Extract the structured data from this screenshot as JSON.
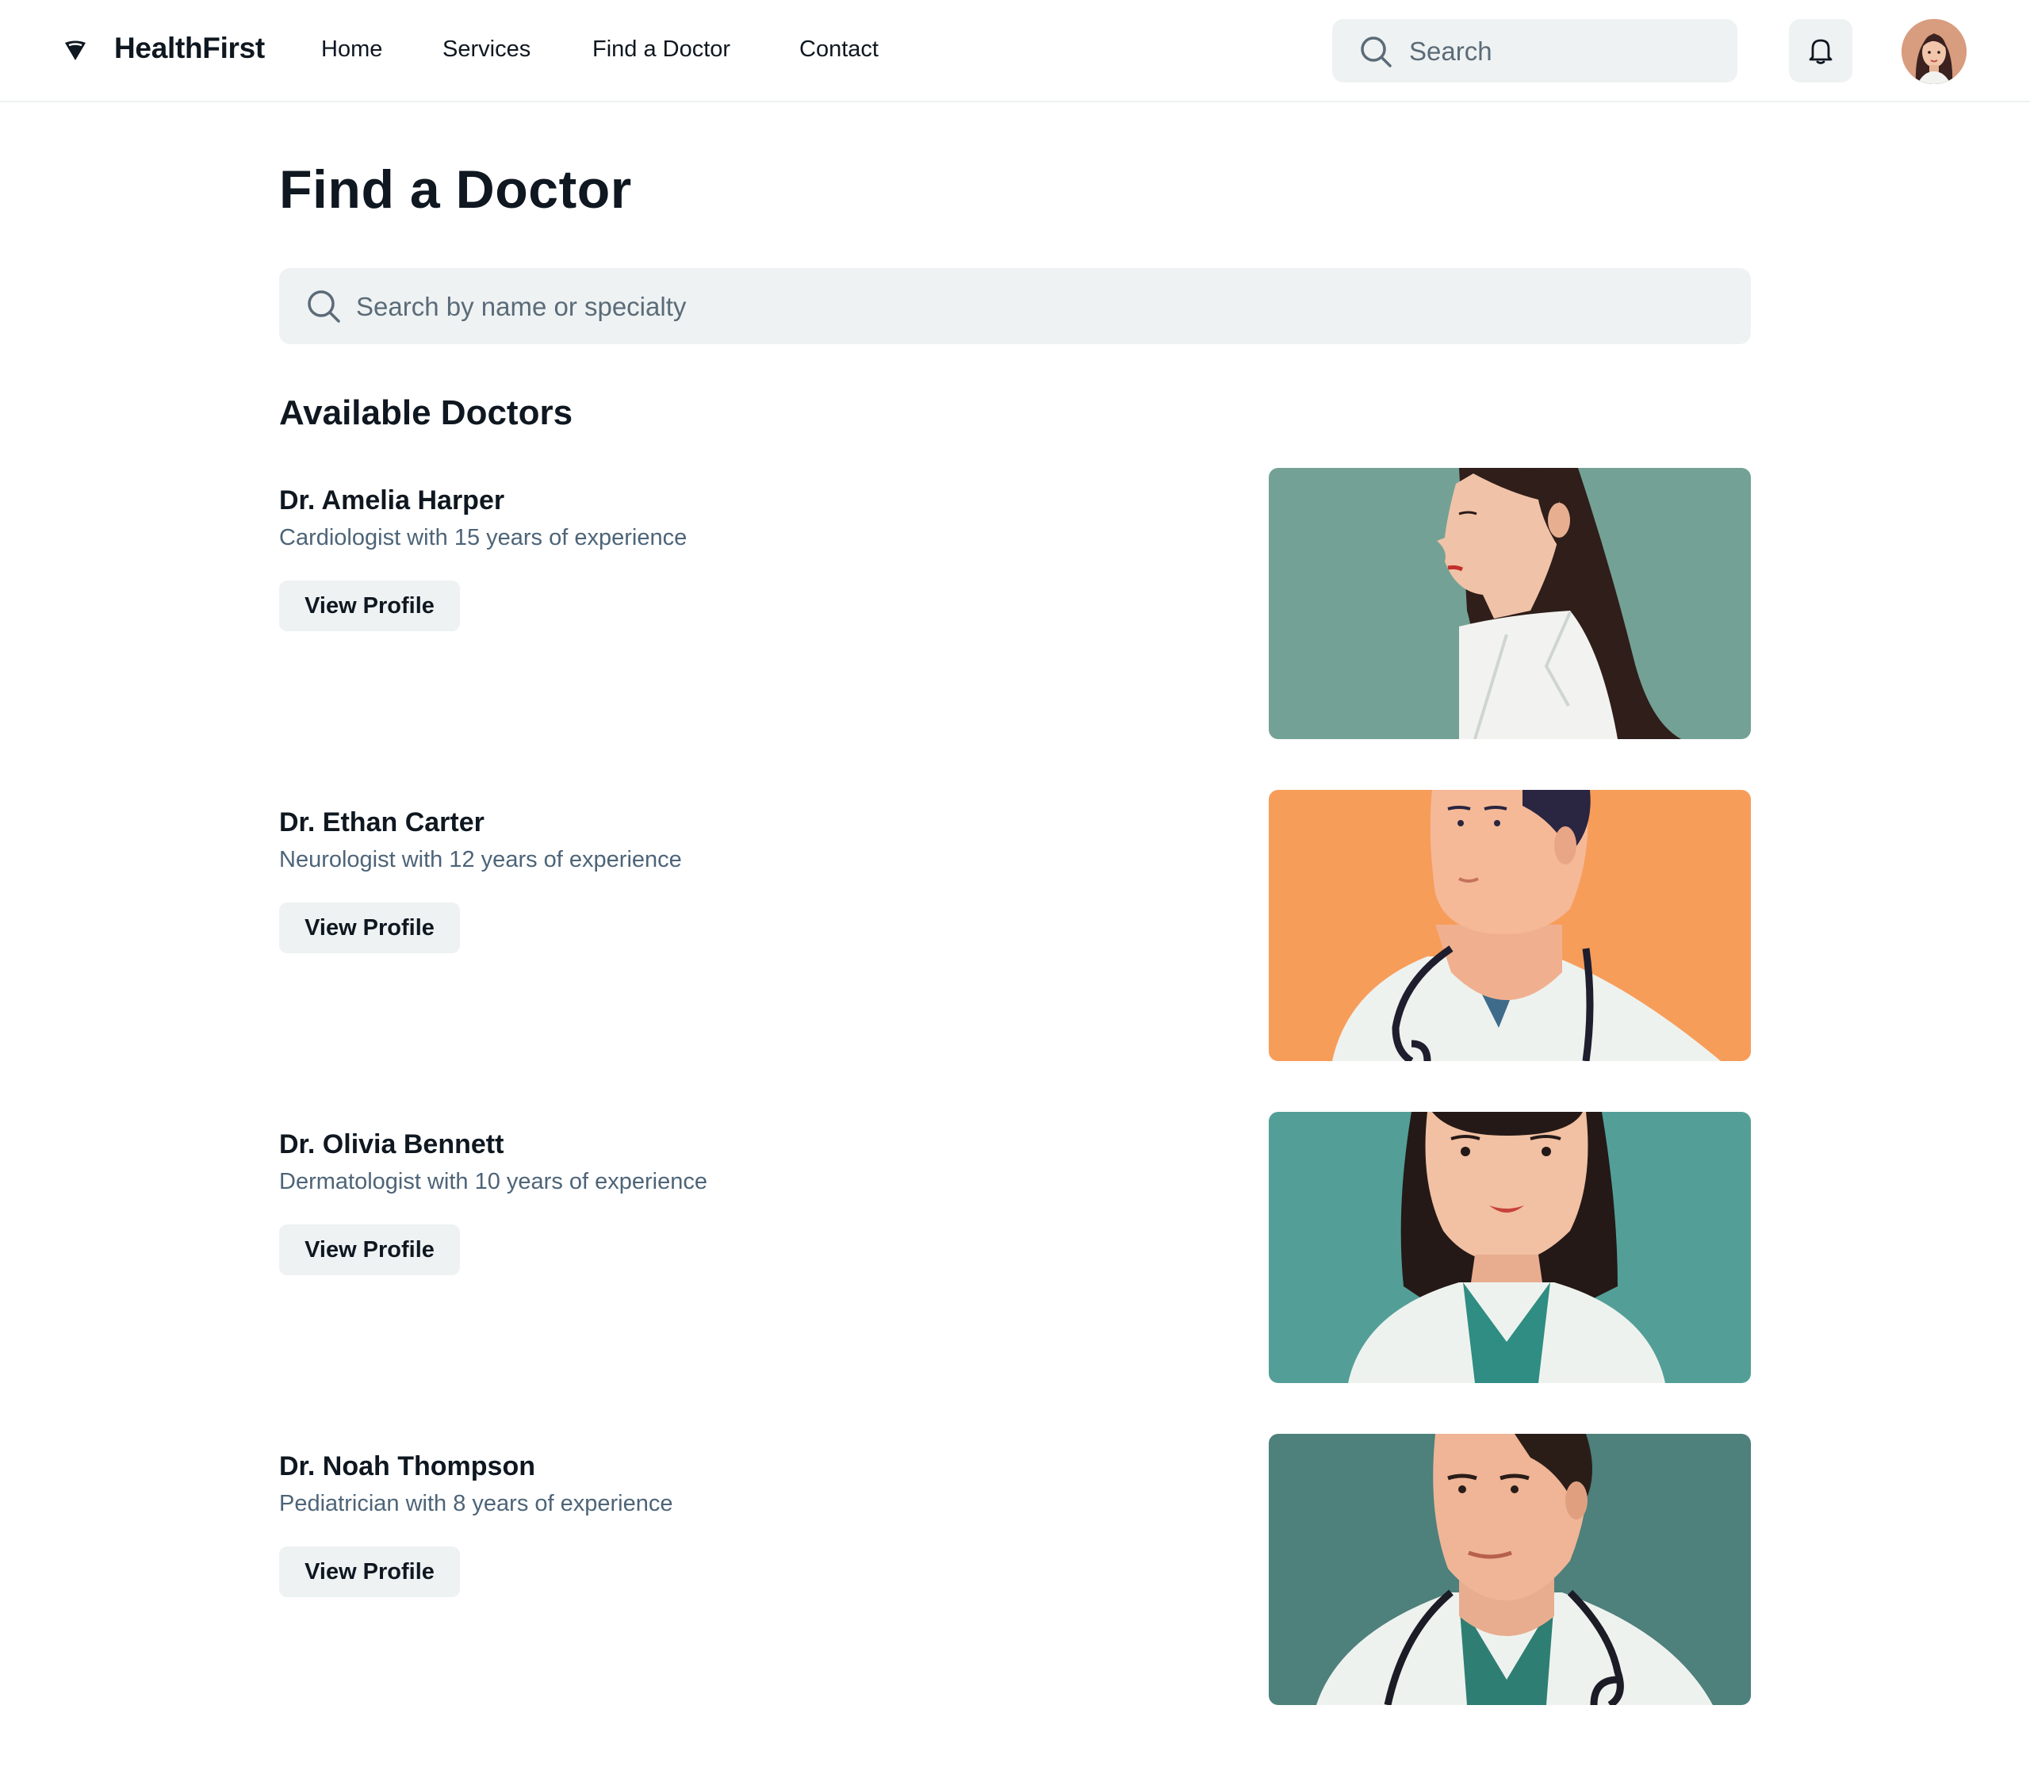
{
  "header": {
    "brand": "HealthFirst",
    "nav": [
      "Home",
      "Services",
      "Find a Doctor",
      "Contact"
    ],
    "search_placeholder": "Search"
  },
  "main": {
    "title": "Find a Doctor",
    "search_placeholder": "Search by name or specialty",
    "section_title": "Available Doctors",
    "doctors": [
      {
        "name": "Dr. Amelia Harper",
        "description": "Cardiologist with 15 years of experience",
        "button": "View Profile",
        "photo_bg": "#74a195"
      },
      {
        "name": "Dr. Ethan Carter",
        "description": "Neurologist with 12 years of experience",
        "button": "View Profile",
        "photo_bg": "#f79d5a"
      },
      {
        "name": "Dr. Olivia Bennett",
        "description": "Dermatologist with 10 years of experience",
        "button": "View Profile",
        "photo_bg": "#539f98"
      },
      {
        "name": "Dr. Noah Thompson",
        "description": "Pediatrician with 8 years of experience",
        "button": "View Profile",
        "photo_bg": "#4e807c"
      }
    ]
  },
  "colors": {
    "text_primary": "#0f1720",
    "text_secondary": "#4d6478",
    "surface": "#eef2f3"
  }
}
